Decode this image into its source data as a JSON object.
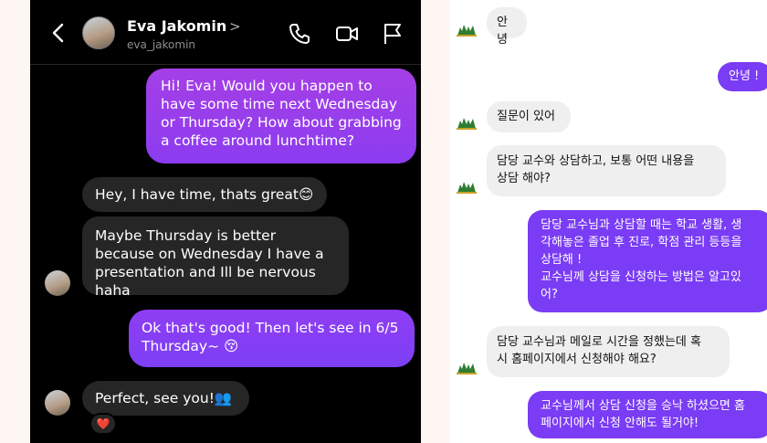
{
  "left_chat": {
    "header": {
      "name": "Eva Jakomin",
      "chevron": ">",
      "username": "eva_jakomin",
      "icons": [
        "back-chevron-icon",
        "avatar",
        "phone-icon",
        "video-camera-icon",
        "flag-icon"
      ]
    },
    "messages": [
      {
        "from": "me",
        "text": "Hi! Eva! Would you happen to have some time next Wednesday or Thursday? How about grabbing a coffee around lunchtime?"
      },
      {
        "from": "them",
        "text": "Hey, I have time, thats great😊"
      },
      {
        "from": "them",
        "text": "Maybe Thursday is better because on Wednesday I have a presentation and Ill be nervous haha"
      },
      {
        "from": "me",
        "text": "Ok that's good! Then let's see in 6/5 Thursday~ 😚"
      },
      {
        "from": "them",
        "text": "Perfect, see you!👥"
      }
    ],
    "reaction": "❤️"
  },
  "right_chat": {
    "messages": [
      {
        "from": "them",
        "text": "안녕"
      },
      {
        "from": "me",
        "text": "안녕 !"
      },
      {
        "from": "them",
        "text": "질문이 있어"
      },
      {
        "from": "them",
        "lines": [
          "담당 교수와 상담하고, 보통 어떤 내용을",
          "상담 해야?"
        ]
      },
      {
        "from": "me",
        "lines": [
          "담당 교수님과 상담할 때는 학교 생활, 생",
          "각해놓은 졸업 후 진로, 학점 관리 등등을",
          "상담해 !",
          "교수님께 상담을 신청하는 방법은 알고있",
          "어?"
        ]
      },
      {
        "from": "them",
        "lines": [
          "담당 교수님과 메일로 시간을 정했는데 혹",
          "시 홈페이지에서 신청해야 해요?"
        ]
      },
      {
        "from": "me",
        "lines": [
          "교수님께서 상담 신청을 승낙 하셨으면 홈",
          "페이지에서 신청 안해도 될거야!"
        ]
      }
    ]
  }
}
